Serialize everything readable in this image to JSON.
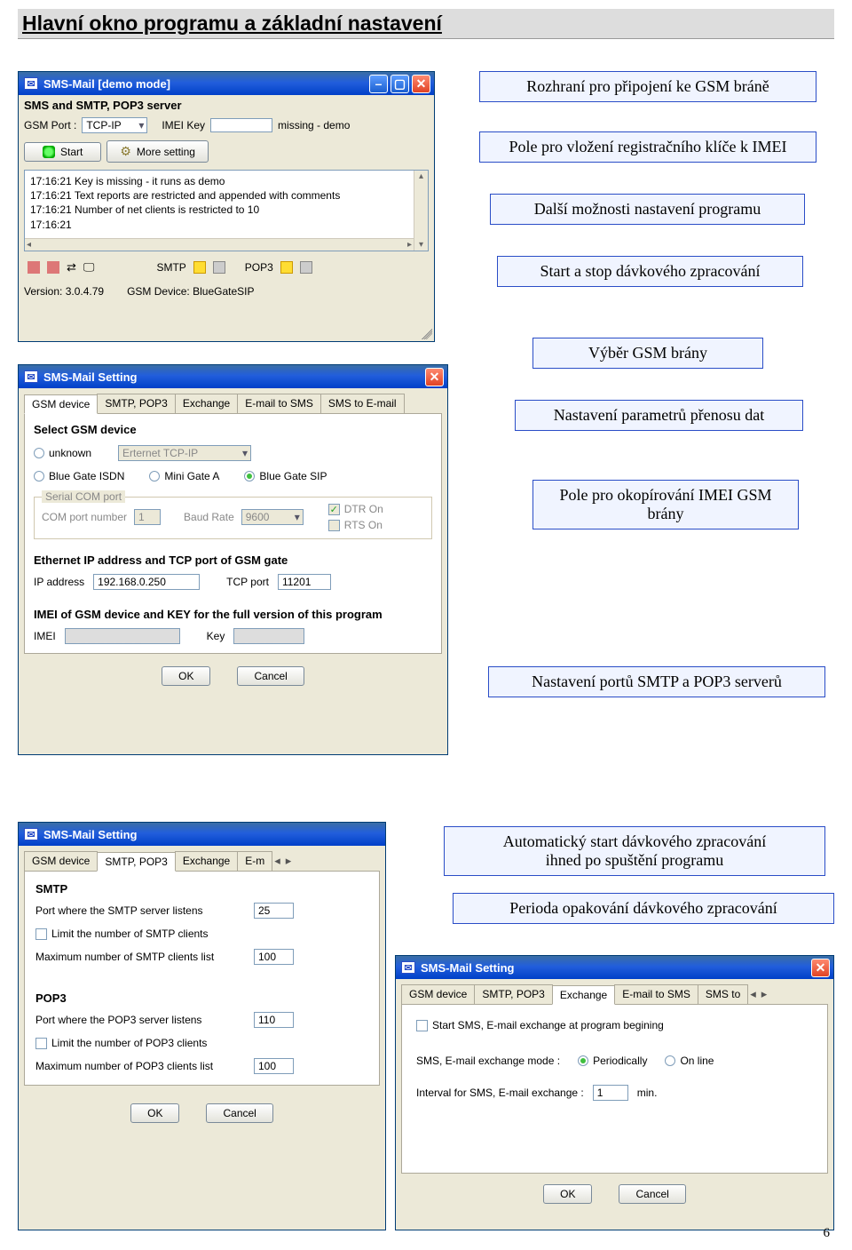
{
  "doc": {
    "title": "Hlavní okno programu a základní nastavení",
    "page_number": "6"
  },
  "callouts": {
    "c1": "Rozhraní pro připojení ke GSM bráně",
    "c2": "Pole pro vložení registračního klíče k IMEI",
    "c3": "Další možnosti nastavení programu",
    "c4": "Start a stop dávkového zpracování",
    "c5": "Výběr GSM brány",
    "c6": "Nastavení parametrů přenosu dat",
    "c7": "Pole pro okopírování IMEI GSM brány",
    "c8": "Nastavení portů SMTP a POP3 serverů",
    "c9_a": "Automatický start dávkového zpracování",
    "c9_b": "ihned po spuštění programu",
    "c10": "Perioda opakování dávkového zpracování"
  },
  "main_window": {
    "title": "SMS-Mail  [demo mode]",
    "subtitle": "SMS and SMTP, POP3 server",
    "gsm_port_label": "GSM Port :",
    "gsm_port_value": "TCP-IP",
    "imei_key_label": "IMEI Key",
    "imei_key_status": "missing - demo",
    "start_label": "Start",
    "more_label": "More setting",
    "log": [
      "17:16:21  Key is missing - it runs as demo",
      "17:16:21  Text reports are restricted and appended with comments",
      "17:16:21  Number of net clients is restricted to 10",
      "17:16:21"
    ],
    "status": {
      "smtp": "SMTP",
      "pop3": "POP3",
      "version_label": "Version: 3.0.4.79",
      "device_label": "GSM Device: BlueGateSIP"
    }
  },
  "settings1": {
    "title": "SMS-Mail Setting",
    "tabs": [
      "GSM device",
      "SMTP, POP3",
      "Exchange",
      "E-mail to SMS",
      "SMS to E-mail"
    ],
    "active_tab": 0,
    "group_select": "Select GSM device",
    "opt_unknown": "unknown",
    "eth_select": "Erternet TCP-IP",
    "opt_isdn": "Blue Gate ISDN",
    "opt_mini": "Mini Gate A",
    "opt_sip": "Blue Gate SIP",
    "group_serial": "Serial COM port",
    "com_label": "COM port number",
    "com_value": "1",
    "baud_label": "Baud Rate",
    "baud_value": "9600",
    "dtr": "DTR On",
    "rts": "RTS On",
    "group_eth": "Ethernet IP address and TCP port of GSM gate",
    "ip_label": "IP address",
    "ip_value": "192.168.0.250",
    "tcp_label": "TCP port",
    "tcp_value": "11201",
    "group_imei": "IMEI of GSM device and KEY for the full version of this program",
    "imei_label": "IMEI",
    "key_label": "Key",
    "ok": "OK",
    "cancel": "Cancel"
  },
  "settings2": {
    "title": "SMS-Mail Setting",
    "tabs": [
      "GSM device",
      "SMTP, POP3",
      "Exchange",
      "E-m"
    ],
    "active_tab": 1,
    "smtp_label": "SMTP",
    "smtp_port_label": "Port where the SMTP server listens",
    "smtp_port": "25",
    "smtp_limit": "Limit the number of SMTP clients",
    "smtp_max_label": "Maximum number of SMTP clients list",
    "smtp_max": "100",
    "pop3_label": "POP3",
    "pop3_port_label": "Port where the POP3 server listens",
    "pop3_port": "110",
    "pop3_limit": "Limit the number of POP3 clients",
    "pop3_max_label": "Maximum number of POP3 clients list",
    "pop3_max": "100",
    "ok": "OK",
    "cancel": "Cancel"
  },
  "settings3": {
    "title": "SMS-Mail Setting",
    "tabs": [
      "GSM device",
      "SMTP, POP3",
      "Exchange",
      "E-mail to SMS",
      "SMS to"
    ],
    "active_tab": 2,
    "start_check": "Start SMS, E-mail exchange at program begining",
    "mode_label": "SMS, E-mail exchange mode :",
    "mode_periodic": "Periodically",
    "mode_online": "On line",
    "interval_label": "Interval for SMS, E-mail exchange :",
    "interval_value": "1",
    "interval_unit": "min.",
    "ok": "OK",
    "cancel": "Cancel"
  }
}
